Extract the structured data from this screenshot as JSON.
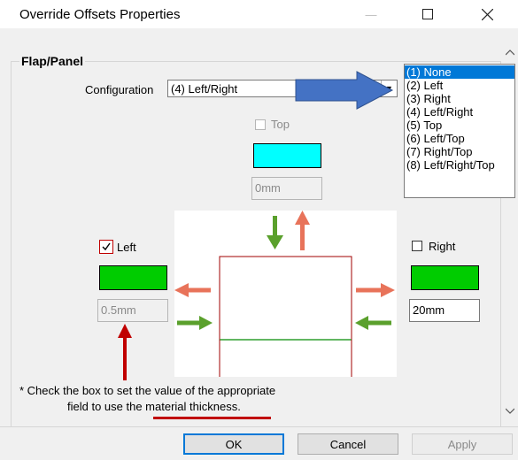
{
  "window": {
    "title": "Override Offsets Properties",
    "minimize_glyph": "—",
    "maximize_glyph": "☐",
    "close_glyph": "✕"
  },
  "group": {
    "label": "Flap/Panel"
  },
  "configuration": {
    "label": "Configuration",
    "selected": "(4) Left/Right",
    "options": [
      "(1) None",
      "(2) Left",
      "(3) Right",
      "(4) Left/Right",
      "(5) Top",
      "(6) Left/Top",
      "(7) Right/Top",
      "(8) Left/Right/Top"
    ],
    "highlighted_option": "(1) None"
  },
  "top": {
    "label": "Top",
    "checked": false,
    "enabled": false,
    "color": "#00ffff",
    "value": "0mm"
  },
  "left": {
    "label": "Left",
    "checked": true,
    "enabled": true,
    "color": "#00cc00",
    "value": "0.5mm"
  },
  "right": {
    "label": "Right",
    "checked": false,
    "enabled": true,
    "color": "#00cc00",
    "value": "20mm"
  },
  "note": {
    "line1": "* Check the box to set the value of the appropriate",
    "line2_prefix": "field to use the ",
    "line2_link": "material thickness",
    "line2_suffix": "."
  },
  "buttons": {
    "ok": "OK",
    "cancel": "Cancel",
    "apply": "Apply"
  },
  "colors": {
    "accent": "#0078d7",
    "annotation_red": "#c00000",
    "arrow_blue": "#4472c4",
    "arrow_green": "#5aa02c",
    "arrow_coral": "#e8735a"
  }
}
